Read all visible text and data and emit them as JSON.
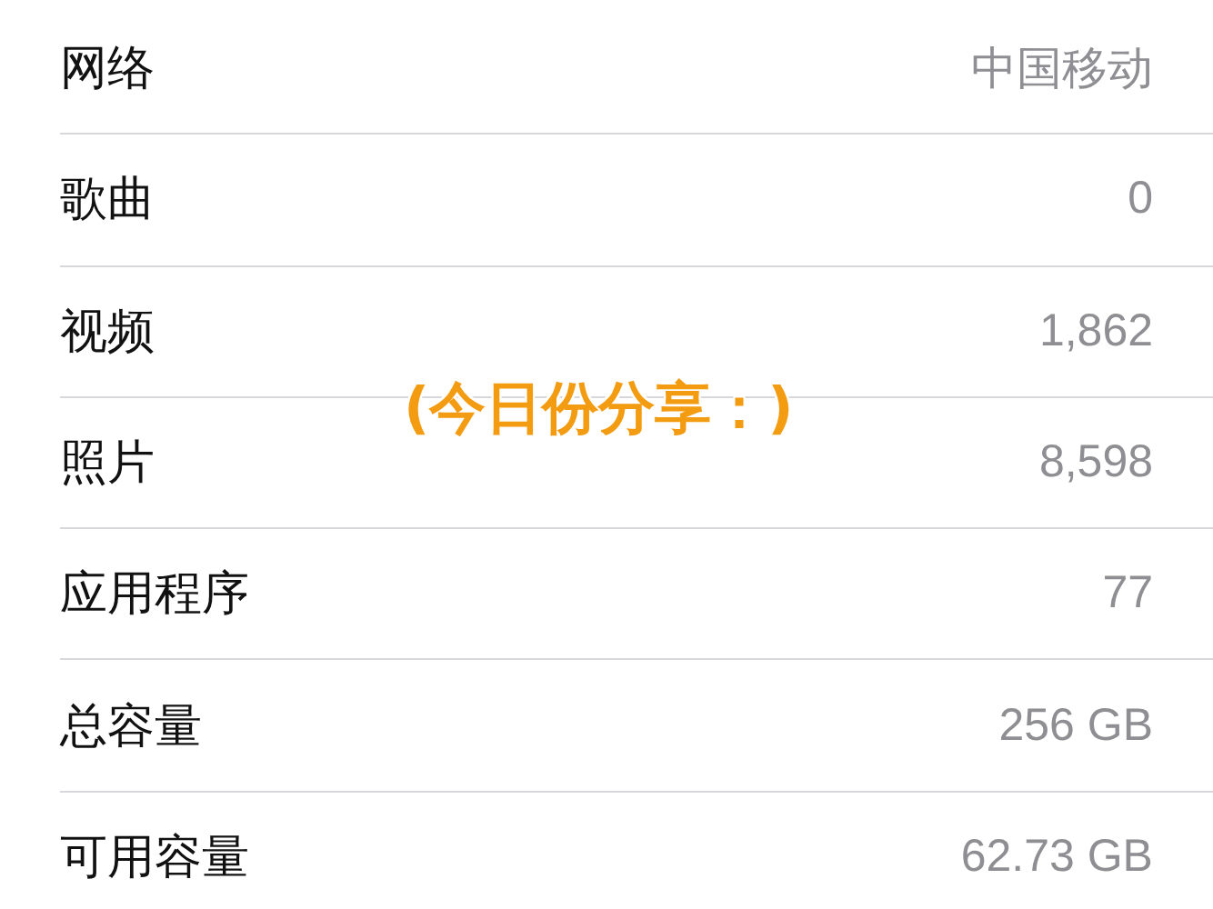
{
  "rows": [
    {
      "label": "网络",
      "value": "中国移动"
    },
    {
      "label": "歌曲",
      "value": "0"
    },
    {
      "label": "视频",
      "value": "1,862"
    },
    {
      "label": "照片",
      "value": "8,598"
    },
    {
      "label": "应用程序",
      "value": "77"
    },
    {
      "label": "总容量",
      "value": "256 GB"
    },
    {
      "label": "可用容量",
      "value": "62.73 GB"
    }
  ],
  "caption": "(今日份分享：)"
}
